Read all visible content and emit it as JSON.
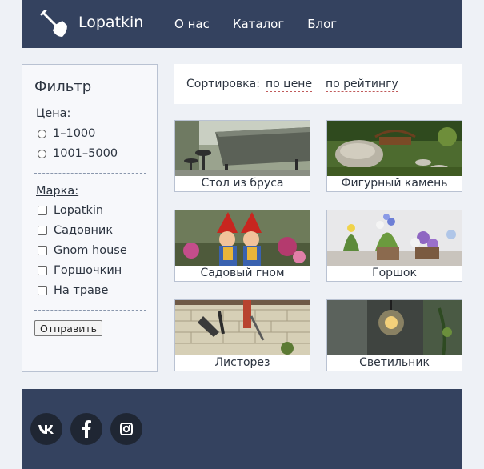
{
  "header": {
    "logo_icon": "shovel-icon",
    "brand": "Lopatkin",
    "nav": [
      {
        "label": "О нас"
      },
      {
        "label": "Каталог"
      },
      {
        "label": "Блог"
      }
    ]
  },
  "filter": {
    "title": "Фильтр",
    "price_label": "Цена:",
    "price_options": [
      "1–1000",
      "1001–5000"
    ],
    "brand_label": "Марка:",
    "brand_options": [
      "Lopatkin",
      "Садовник",
      "Gnom house",
      "Горшочкин",
      "На траве"
    ],
    "submit_label": "Отправить"
  },
  "sort": {
    "label": "Сортировка:",
    "by_price": "по цене",
    "by_rating": "по рейтингу"
  },
  "products": [
    {
      "name": "Стол из бруса"
    },
    {
      "name": "Фигурный камень"
    },
    {
      "name": "Садовый гном"
    },
    {
      "name": "Горшок"
    },
    {
      "name": "Листорез"
    },
    {
      "name": "Светильник"
    }
  ],
  "footer": {
    "social": [
      "vk-icon",
      "facebook-icon",
      "instagram-icon"
    ]
  },
  "colors": {
    "header_bg": "#34425f",
    "page_bg": "#eef1f6",
    "accent_underline": "#c05a5a"
  }
}
